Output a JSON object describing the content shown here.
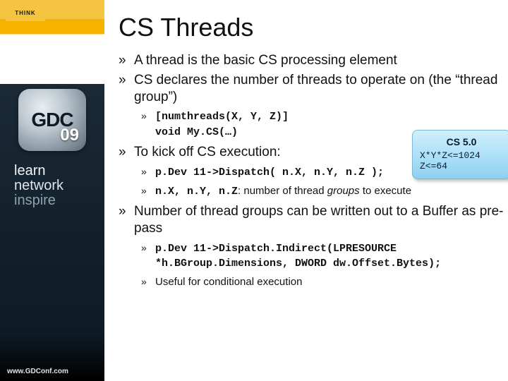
{
  "brand": {
    "think": "THINK",
    "gdc": "GDC",
    "year": "09",
    "tag1": "learn",
    "tag2": "network",
    "tag3": "inspire",
    "footer": "www.GDConf.com"
  },
  "title": "CS Threads",
  "b1": "A thread is the basic CS processing element",
  "b2": "CS declares the number of threads to operate on (the “thread group”)",
  "b2_code1": "[numthreads(X, Y, Z)]",
  "b2_code2": "void My.CS(…)",
  "b3": "To kick off CS execution:",
  "b3_code": "p.Dev 11->Dispatch( n.X, n.Y, n.Z );",
  "b3_sub2_pre": "n.X, n.Y, n.Z",
  "b3_sub2_mid": ": number of thread ",
  "b3_sub2_ital": "groups",
  "b3_sub2_post": " to execute",
  "b4": "Number of thread groups can be written out to a Buffer as pre-pass",
  "b4_code": "p.Dev 11->Dispatch.Indirect(LPRESOURCE *h.BGroup.Dimensions, DWORD dw.Offset.Bytes);",
  "b4_sub2": "Useful for conditional execution",
  "callout": {
    "title": "CS 5.0",
    "row1": "X*Y*Z<=1024",
    "row2": "Z<=64"
  }
}
